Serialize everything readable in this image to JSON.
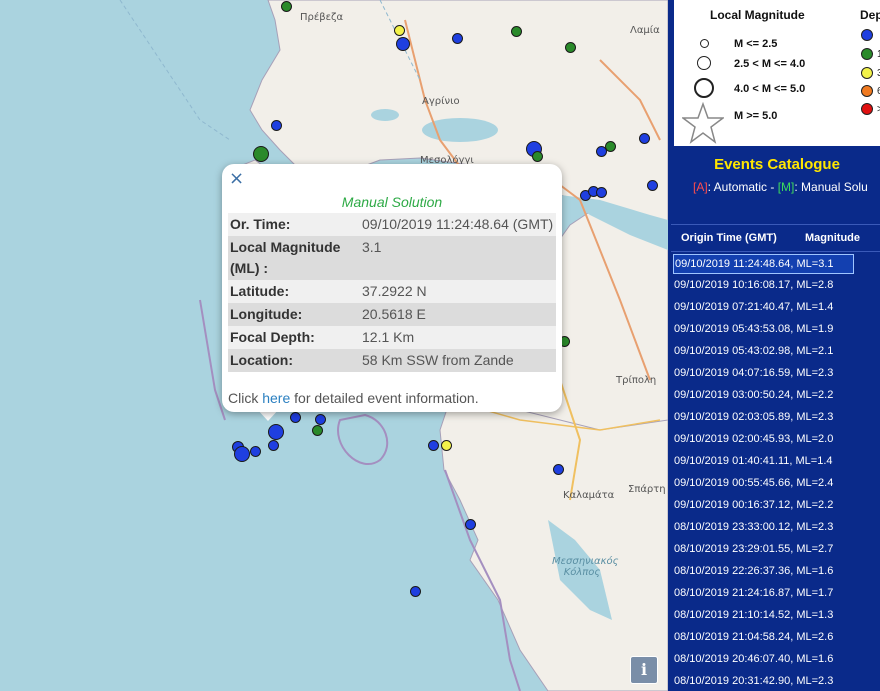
{
  "map": {
    "places": {
      "preveza": "Πρέβεζα",
      "lamia": "Λαμία",
      "agrinio": "Αγρίνιο",
      "mesolongi": "Μεσολόγγι",
      "tripoli": "Τρίπολη",
      "kalamata": "Καλαμάτα",
      "sparti": "Σπάρτη",
      "messiniakos": "Μεσσηνιακός Κόλπος"
    },
    "info_button": "i"
  },
  "popup": {
    "close": "×",
    "title": "Manual Solution",
    "rows": [
      {
        "label": "Or. Time:",
        "value": "09/10/2019 11:24:48.64 (GMT)"
      },
      {
        "label": "Local Magnitude (ML) :",
        "value": "3.1"
      },
      {
        "label": "Latitude:",
        "value": "37.2922 N"
      },
      {
        "label": "Longitude:",
        "value": "20.5618 E"
      },
      {
        "label": "Focal Depth:",
        "value": "12.1 Km"
      },
      {
        "label": "Location:",
        "value": "58 Km SSW from Zande"
      }
    ],
    "footer_pre": "Click ",
    "footer_link": "here",
    "footer_post": " for detailed event information."
  },
  "legend": {
    "title": "Local Magnitude",
    "depth_title": "Dep",
    "rows": [
      "M <= 2.5",
      "2.5 < M <= 4.0",
      "4.0 < M <= 5.0",
      "M >= 5.0"
    ],
    "depth_colors": [
      "#1f3fe0",
      "#2a8a2a",
      "#f2f24a",
      "#f07a20",
      "#e01010"
    ],
    "depth_labels": [
      "",
      "1",
      "3",
      "6",
      ">"
    ]
  },
  "catalogue": {
    "title": "Events Catalogue",
    "sub_a": "[A]",
    "sub_a_text": ": Automatic - ",
    "sub_m": "[M]",
    "sub_m_text": ": Manual Solu",
    "col_time": "Origin Time (GMT)",
    "col_mag": "Magnitude",
    "events": [
      "09/10/2019 11:24:48.64, ML=3.1",
      "09/10/2019 10:16:08.17, ML=2.8",
      "09/10/2019 07:21:40.47, ML=1.4",
      "09/10/2019 05:43:53.08, ML=1.9",
      "09/10/2019 05:43:02.98, ML=2.1",
      "09/10/2019 04:07:16.59, ML=2.3",
      "09/10/2019 03:00:50.24, ML=2.2",
      "09/10/2019 02:03:05.89, ML=2.3",
      "09/10/2019 02:00:45.93, ML=2.0",
      "09/10/2019 01:40:41.11, ML=1.4",
      "09/10/2019 00:55:45.66, ML=2.4",
      "09/10/2019 00:16:37.12, ML=2.2",
      "08/10/2019 23:33:00.12, ML=2.3",
      "08/10/2019 23:29:01.55, ML=2.7",
      "08/10/2019 22:26:37.36, ML=1.6",
      "08/10/2019 21:24:16.87, ML=1.7",
      "08/10/2019 21:10:14.52, ML=1.3",
      "08/10/2019 21:04:58.24, ML=2.6",
      "08/10/2019 20:46:07.40, ML=1.6",
      "08/10/2019 20:31:42.90, ML=2.3"
    ]
  }
}
